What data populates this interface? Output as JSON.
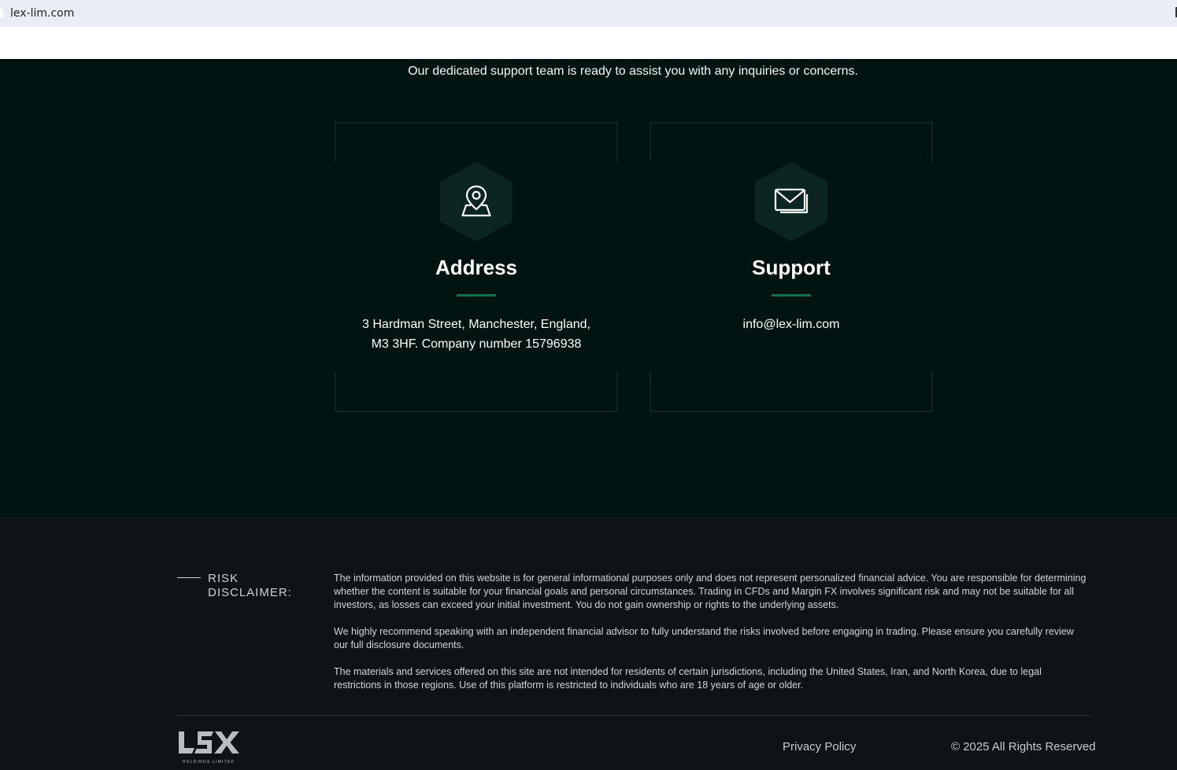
{
  "browser": {
    "url": "lex-lim.com"
  },
  "contact": {
    "tagline": "Our dedicated support team is ready to assist you with any inquiries or concerns.",
    "address": {
      "icon": "map-pin-icon",
      "title": "Address",
      "line1": "3 Hardman Street, Manchester, England,",
      "line2": "M3 3HF. Company number 15796938"
    },
    "support": {
      "icon": "envelope-icon",
      "title": "Support",
      "email": "info@lex-lim.com"
    },
    "colors": {
      "background": "#021412",
      "accent": "#15704f",
      "card_border": "#0d2622",
      "hex_bg": "#0a2522"
    }
  },
  "footer": {
    "risk_title_line1": "RISK",
    "risk_title_line2": "DISCLAIMER:",
    "paragraphs": [
      "The information provided on this website is for general informational purposes only and does not represent personalized financial advice. You are responsible for determining whether the content is suitable for your financial goals and personal circumstances. Trading in CFDs and Margin FX involves significant risk and may not be suitable for all investors, as losses can exceed your initial investment. You do not gain ownership or rights to the underlying assets.",
      "We highly recommend speaking with an independent financial advisor to fully understand the risks involved before engaging in trading. Please ensure you carefully review our full disclosure documents.",
      "The materials and services offered on this site are not intended for residents of certain jurisdictions, including the United States, Iran, and North Korea, due to legal restrictions in those regions. Use of this platform is restricted to individuals who are 18 years of age or older."
    ],
    "logo_text": "LSX",
    "logo_subtext": "HOLDINGS LIMITED",
    "privacy": "Privacy Policy",
    "copyright": "© 2025 All Rights Reserved",
    "colors": {
      "background": "#0f1315"
    }
  }
}
